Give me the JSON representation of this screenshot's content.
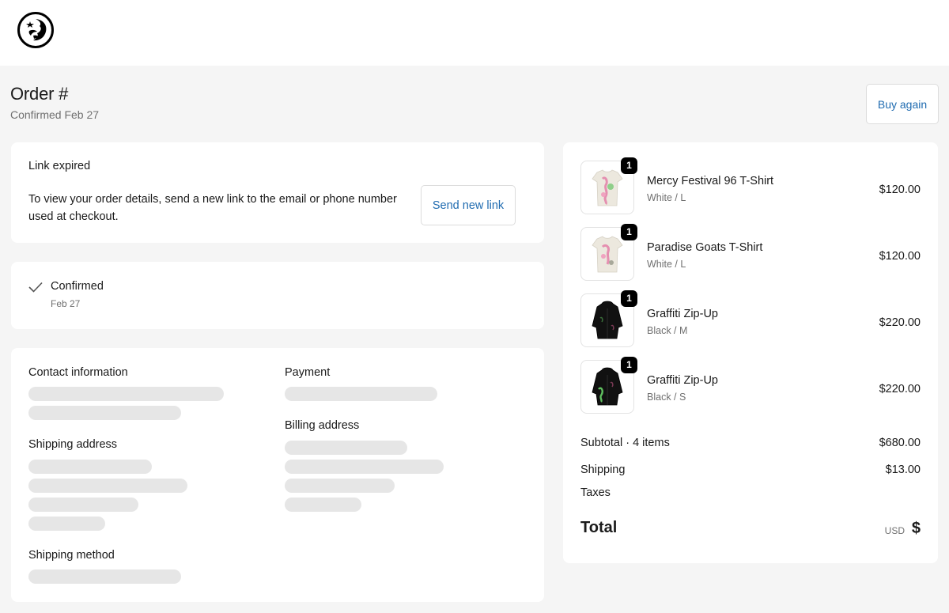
{
  "header": {
    "logo": "hellstar-logo"
  },
  "order": {
    "title": "Order #",
    "subtitle": "Confirmed Feb 27",
    "buy_again": "Buy again"
  },
  "link_card": {
    "heading": "Link expired",
    "line1": "To view your order details, send a new link to the email or phone number",
    "line2": "used at checkout.",
    "button": "Send new link"
  },
  "status": {
    "icon": "check-icon",
    "label": "Confirmed",
    "date": "Feb 27"
  },
  "details": {
    "contact": "Contact information",
    "payment": "Payment",
    "shipping_address": "Shipping address",
    "billing_address": "Billing address",
    "shipping_method": "Shipping method"
  },
  "items": [
    {
      "name": "Mercy Festival 96 T-Shirt",
      "variant": "White / L",
      "price": "$120.00",
      "qty": "1",
      "image": "white-tshirt"
    },
    {
      "name": "Paradise Goats T-Shirt",
      "variant": "White / L",
      "price": "$120.00",
      "qty": "1",
      "image": "white-tshirt"
    },
    {
      "name": "Graffiti Zip-Up",
      "variant": "Black / M",
      "price": "$220.00",
      "qty": "1",
      "image": "black-hoodie"
    },
    {
      "name": "Graffiti Zip-Up",
      "variant": "Black / S",
      "price": "$220.00",
      "qty": "1",
      "image": "black-hoodie"
    }
  ],
  "summary": {
    "subtotal_label": "Subtotal · 4 items",
    "subtotal_value": "$680.00",
    "shipping_label": "Shipping",
    "shipping_value": "$13.00",
    "taxes_label": "Taxes",
    "total_label": "Total",
    "currency": "USD",
    "total_value": "$"
  },
  "colors": {
    "link": "#1f6bb0",
    "background": "#f5f5f5",
    "skeleton": "#e6e6e6"
  }
}
